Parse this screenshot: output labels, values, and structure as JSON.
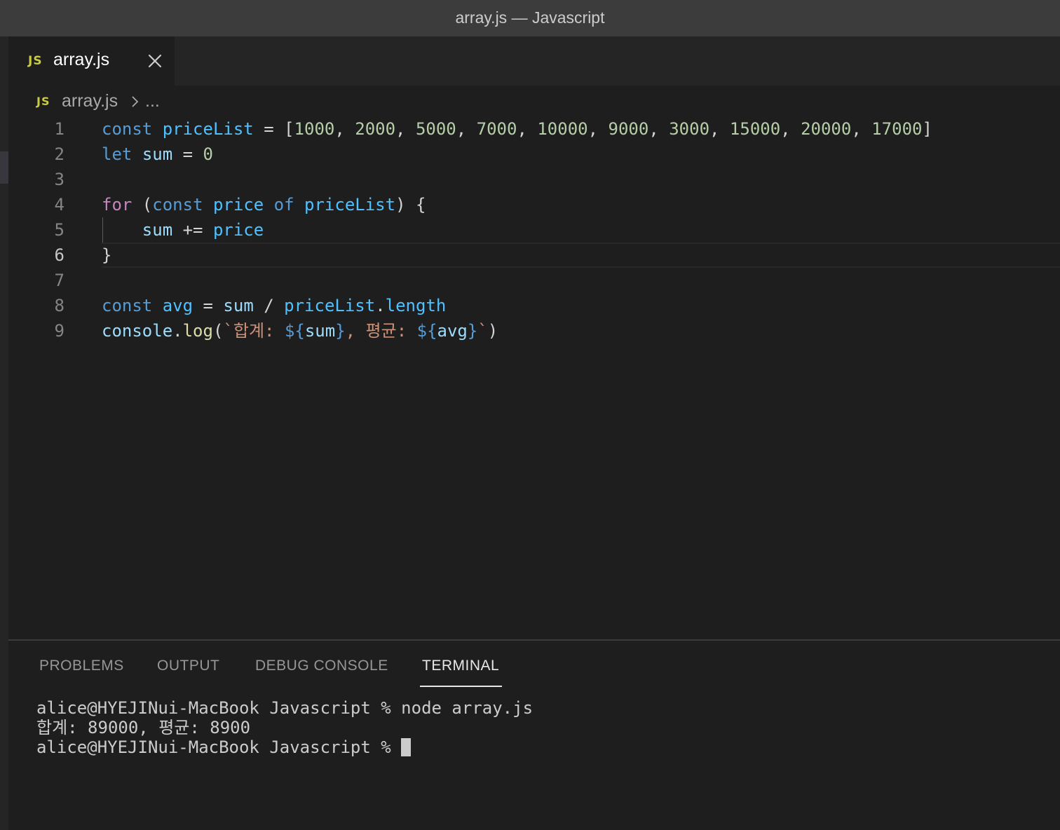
{
  "window": {
    "title": "array.js — Javascript"
  },
  "tab": {
    "icon": "JS",
    "label": "array.js",
    "close_icon": "close-icon"
  },
  "breadcrumb": {
    "icon": "JS",
    "file": "array.js",
    "separator_icon": "chevron-right-icon",
    "ellipsis": "..."
  },
  "editor": {
    "line_numbers": [
      "1",
      "2",
      "3",
      "4",
      "5",
      "6",
      "7",
      "8",
      "9"
    ],
    "active_line": "6",
    "lines": [
      [
        {
          "t": "const",
          "c": "kw"
        },
        {
          "t": " ",
          "c": "punc"
        },
        {
          "t": "priceList",
          "c": "var"
        },
        {
          "t": " = [",
          "c": "punc"
        },
        {
          "t": "1000",
          "c": "num"
        },
        {
          "t": ", ",
          "c": "punc"
        },
        {
          "t": "2000",
          "c": "num"
        },
        {
          "t": ", ",
          "c": "punc"
        },
        {
          "t": "5000",
          "c": "num"
        },
        {
          "t": ", ",
          "c": "punc"
        },
        {
          "t": "7000",
          "c": "num"
        },
        {
          "t": ", ",
          "c": "punc"
        },
        {
          "t": "10000",
          "c": "num"
        },
        {
          "t": ", ",
          "c": "punc"
        },
        {
          "t": "9000",
          "c": "num"
        },
        {
          "t": ", ",
          "c": "punc"
        },
        {
          "t": "3000",
          "c": "num"
        },
        {
          "t": ", ",
          "c": "punc"
        },
        {
          "t": "15000",
          "c": "num"
        },
        {
          "t": ", ",
          "c": "punc"
        },
        {
          "t": "20000",
          "c": "num"
        },
        {
          "t": ", ",
          "c": "punc"
        },
        {
          "t": "17000",
          "c": "num"
        },
        {
          "t": "]",
          "c": "punc"
        }
      ],
      [
        {
          "t": "let",
          "c": "kw"
        },
        {
          "t": " ",
          "c": "punc"
        },
        {
          "t": "sum",
          "c": "id"
        },
        {
          "t": " = ",
          "c": "punc"
        },
        {
          "t": "0",
          "c": "num"
        }
      ],
      [],
      [
        {
          "t": "for",
          "c": "ctl"
        },
        {
          "t": " (",
          "c": "punc"
        },
        {
          "t": "const",
          "c": "kw"
        },
        {
          "t": " ",
          "c": "punc"
        },
        {
          "t": "price",
          "c": "var"
        },
        {
          "t": " ",
          "c": "punc"
        },
        {
          "t": "of",
          "c": "kw"
        },
        {
          "t": " ",
          "c": "punc"
        },
        {
          "t": "priceList",
          "c": "var"
        },
        {
          "t": ") {",
          "c": "punc"
        }
      ],
      [
        {
          "t": "    ",
          "c": "punc"
        },
        {
          "t": "sum",
          "c": "id"
        },
        {
          "t": " += ",
          "c": "punc"
        },
        {
          "t": "price",
          "c": "var"
        }
      ],
      [
        {
          "t": "}",
          "c": "punc"
        }
      ],
      [],
      [
        {
          "t": "const",
          "c": "kw"
        },
        {
          "t": " ",
          "c": "punc"
        },
        {
          "t": "avg",
          "c": "var"
        },
        {
          "t": " = ",
          "c": "punc"
        },
        {
          "t": "sum",
          "c": "id"
        },
        {
          "t": " / ",
          "c": "punc"
        },
        {
          "t": "priceList",
          "c": "var"
        },
        {
          "t": ".",
          "c": "punc"
        },
        {
          "t": "length",
          "c": "var"
        }
      ],
      [
        {
          "t": "console",
          "c": "id"
        },
        {
          "t": ".",
          "c": "punc"
        },
        {
          "t": "log",
          "c": "fn"
        },
        {
          "t": "(",
          "c": "punc"
        },
        {
          "t": "`합계: ",
          "c": "str"
        },
        {
          "t": "${",
          "c": "kw"
        },
        {
          "t": "sum",
          "c": "id"
        },
        {
          "t": "}",
          "c": "kw"
        },
        {
          "t": ", 평균: ",
          "c": "str"
        },
        {
          "t": "${",
          "c": "kw"
        },
        {
          "t": "avg",
          "c": "id"
        },
        {
          "t": "}",
          "c": "kw"
        },
        {
          "t": "`",
          "c": "str"
        },
        {
          "t": ")",
          "c": "punc"
        }
      ]
    ]
  },
  "panel": {
    "tabs": [
      {
        "label": "PROBLEMS",
        "active": false
      },
      {
        "label": "OUTPUT",
        "active": false
      },
      {
        "label": "DEBUG CONSOLE",
        "active": false
      },
      {
        "label": "TERMINAL",
        "active": true
      }
    ],
    "terminal": {
      "lines": [
        "alice@HYEJINui-MacBook Javascript % node array.js",
        "합계: 89000, 평균: 8900"
      ],
      "prompt": "alice@HYEJINui-MacBook Javascript % "
    }
  },
  "colors": {
    "keyword": "#569cd6",
    "control": "#c586c0",
    "variable": "#4fc1ff",
    "identifier": "#9cdcfe",
    "number": "#b5cea8",
    "function": "#dcdcaa",
    "string": "#ce9178",
    "js_icon": "#cbcb41"
  }
}
